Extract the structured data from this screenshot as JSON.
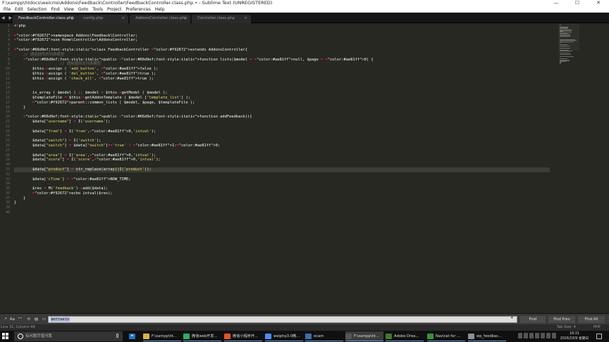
{
  "window": {
    "title": "F:\\xampp\\htdocs\\weicms\\Addons\\Feedback\\Controller\\FeedbackController.class.php • - Sublime Text (UNREGISTERED)",
    "minimize": "—",
    "maximize": "☐",
    "close": "✕"
  },
  "menu": [
    "File",
    "Edit",
    "Selection",
    "Find",
    "View",
    "Goto",
    "Tools",
    "Project",
    "Preferences",
    "Help"
  ],
  "tabs": [
    {
      "label": "FeedbackController.class.php",
      "close": "●"
    },
    {
      "label": "config.php",
      "close": "×"
    },
    {
      "label": "AddonsController.class.php",
      "close": "×"
    },
    {
      "label": "Controller.class.php",
      "close": "×"
    }
  ],
  "tab_nav": "◀ ▶",
  "code_lines": [
    "<?php",
    "",
    "namespace Addons\\Feedback\\Controller;",
    "use Home\\Controller\\AddonsController;",
    "",
    "class FeedbackController extends AddonsController{",
    "    // 通用插件的列表模型",
    "    public function lists($model = null, $page = 0) {",
    "                    // 通用插件的列表模型",
    "        $this->assign ( 'add_button', false );",
    "        $this->assign ( 'del_button', true );",
    "        $this->assign ( 'check_all', true );",
    "",
    "",
    "        is_array ( $model ) || $model = $this->getModel ( $model );",
    "        $templateFile = $this->getAddonTemplate ( $model ['template_list'] );",
    "        parent::common_lists ( $model, $page, $templateFile );",
    "    }",
    "",
    "    public function addFeedback(){",
    "        $data[\"username\"] = I('username');",
    "",
    "        $data[\"from\"] = I('from',0,'intval');",
    "",
    "        $data[\"switch\"] = I('switch');",
    "        $data[\"switch\"] = $data[\"switch\"]=='true' ? 1:0;",
    "",
    "        $data[\"area\"] = I('area',0,'intval');",
    "        $data[\"score\"] = I('score',0,'intval');",
    "",
    "        $data[\"product\"] = str_replace(array()I('product'));",
    "",
    "        $data['cTime'] = NOW_TIME;",
    "",
    "        $res = M('feedback')->add($data);",
    "        echo intval($res);",
    "    }",
    "}",
    "",
    ""
  ],
  "current_line": 31,
  "findbar": {
    "input_value": "$mttaelo",
    "find_label": "Find",
    "find_prev_label": "Find Prev",
    "find_all_label": "Find All",
    "icons": [
      "regex-icon",
      "case-icon",
      "word-icon",
      "wrap-icon",
      "in-selection-icon",
      "highlight-icon"
    ]
  },
  "status": {
    "position": "Line 31, Column 49",
    "tab_size": "Tab Size: 4",
    "syntax": "PHP"
  },
  "taskbar": {
    "search_placeholder": "有问题尽管问我",
    "apps": [
      {
        "label": "F:\\xampp\\ht...",
        "icon": "folder-icon",
        "color": "#d9b44a"
      },
      {
        "label": "微信web开发...",
        "icon": "wechat-devtools-icon",
        "color": "#2aae67"
      },
      {
        "label": "微信小程序开...",
        "icon": "miniprogram-icon",
        "color": "#e0552d"
      },
      {
        "label": "weiphp3.0微...",
        "icon": "chrome-icon",
        "color": "#4c8bf5"
      },
      {
        "label": "ocam",
        "icon": "ocam-icon",
        "color": "#3a6fb0"
      },
      {
        "label": "F:\\xampp\\ht...",
        "icon": "sublime-icon",
        "color": "#555555"
      },
      {
        "label": "Adobe Drea...",
        "icon": "dreamweaver-icon",
        "color": "#3f7a2a"
      },
      {
        "label": "Navicat for ...",
        "icon": "navicat-icon",
        "color": "#3b8e3b"
      },
      {
        "label": "wp_feedbac...",
        "icon": "table-icon",
        "color": "#8f8f8f"
      }
    ],
    "time": "16:31",
    "date": "2016/10/9 星期日"
  },
  "colors": {
    "editor_bg": "#272822",
    "keyword": "#f92672",
    "storage": "#66d9ef",
    "string": "#e6db74",
    "function": "#a6e22e",
    "comment": "#75715e",
    "number": "#ae81ff"
  }
}
